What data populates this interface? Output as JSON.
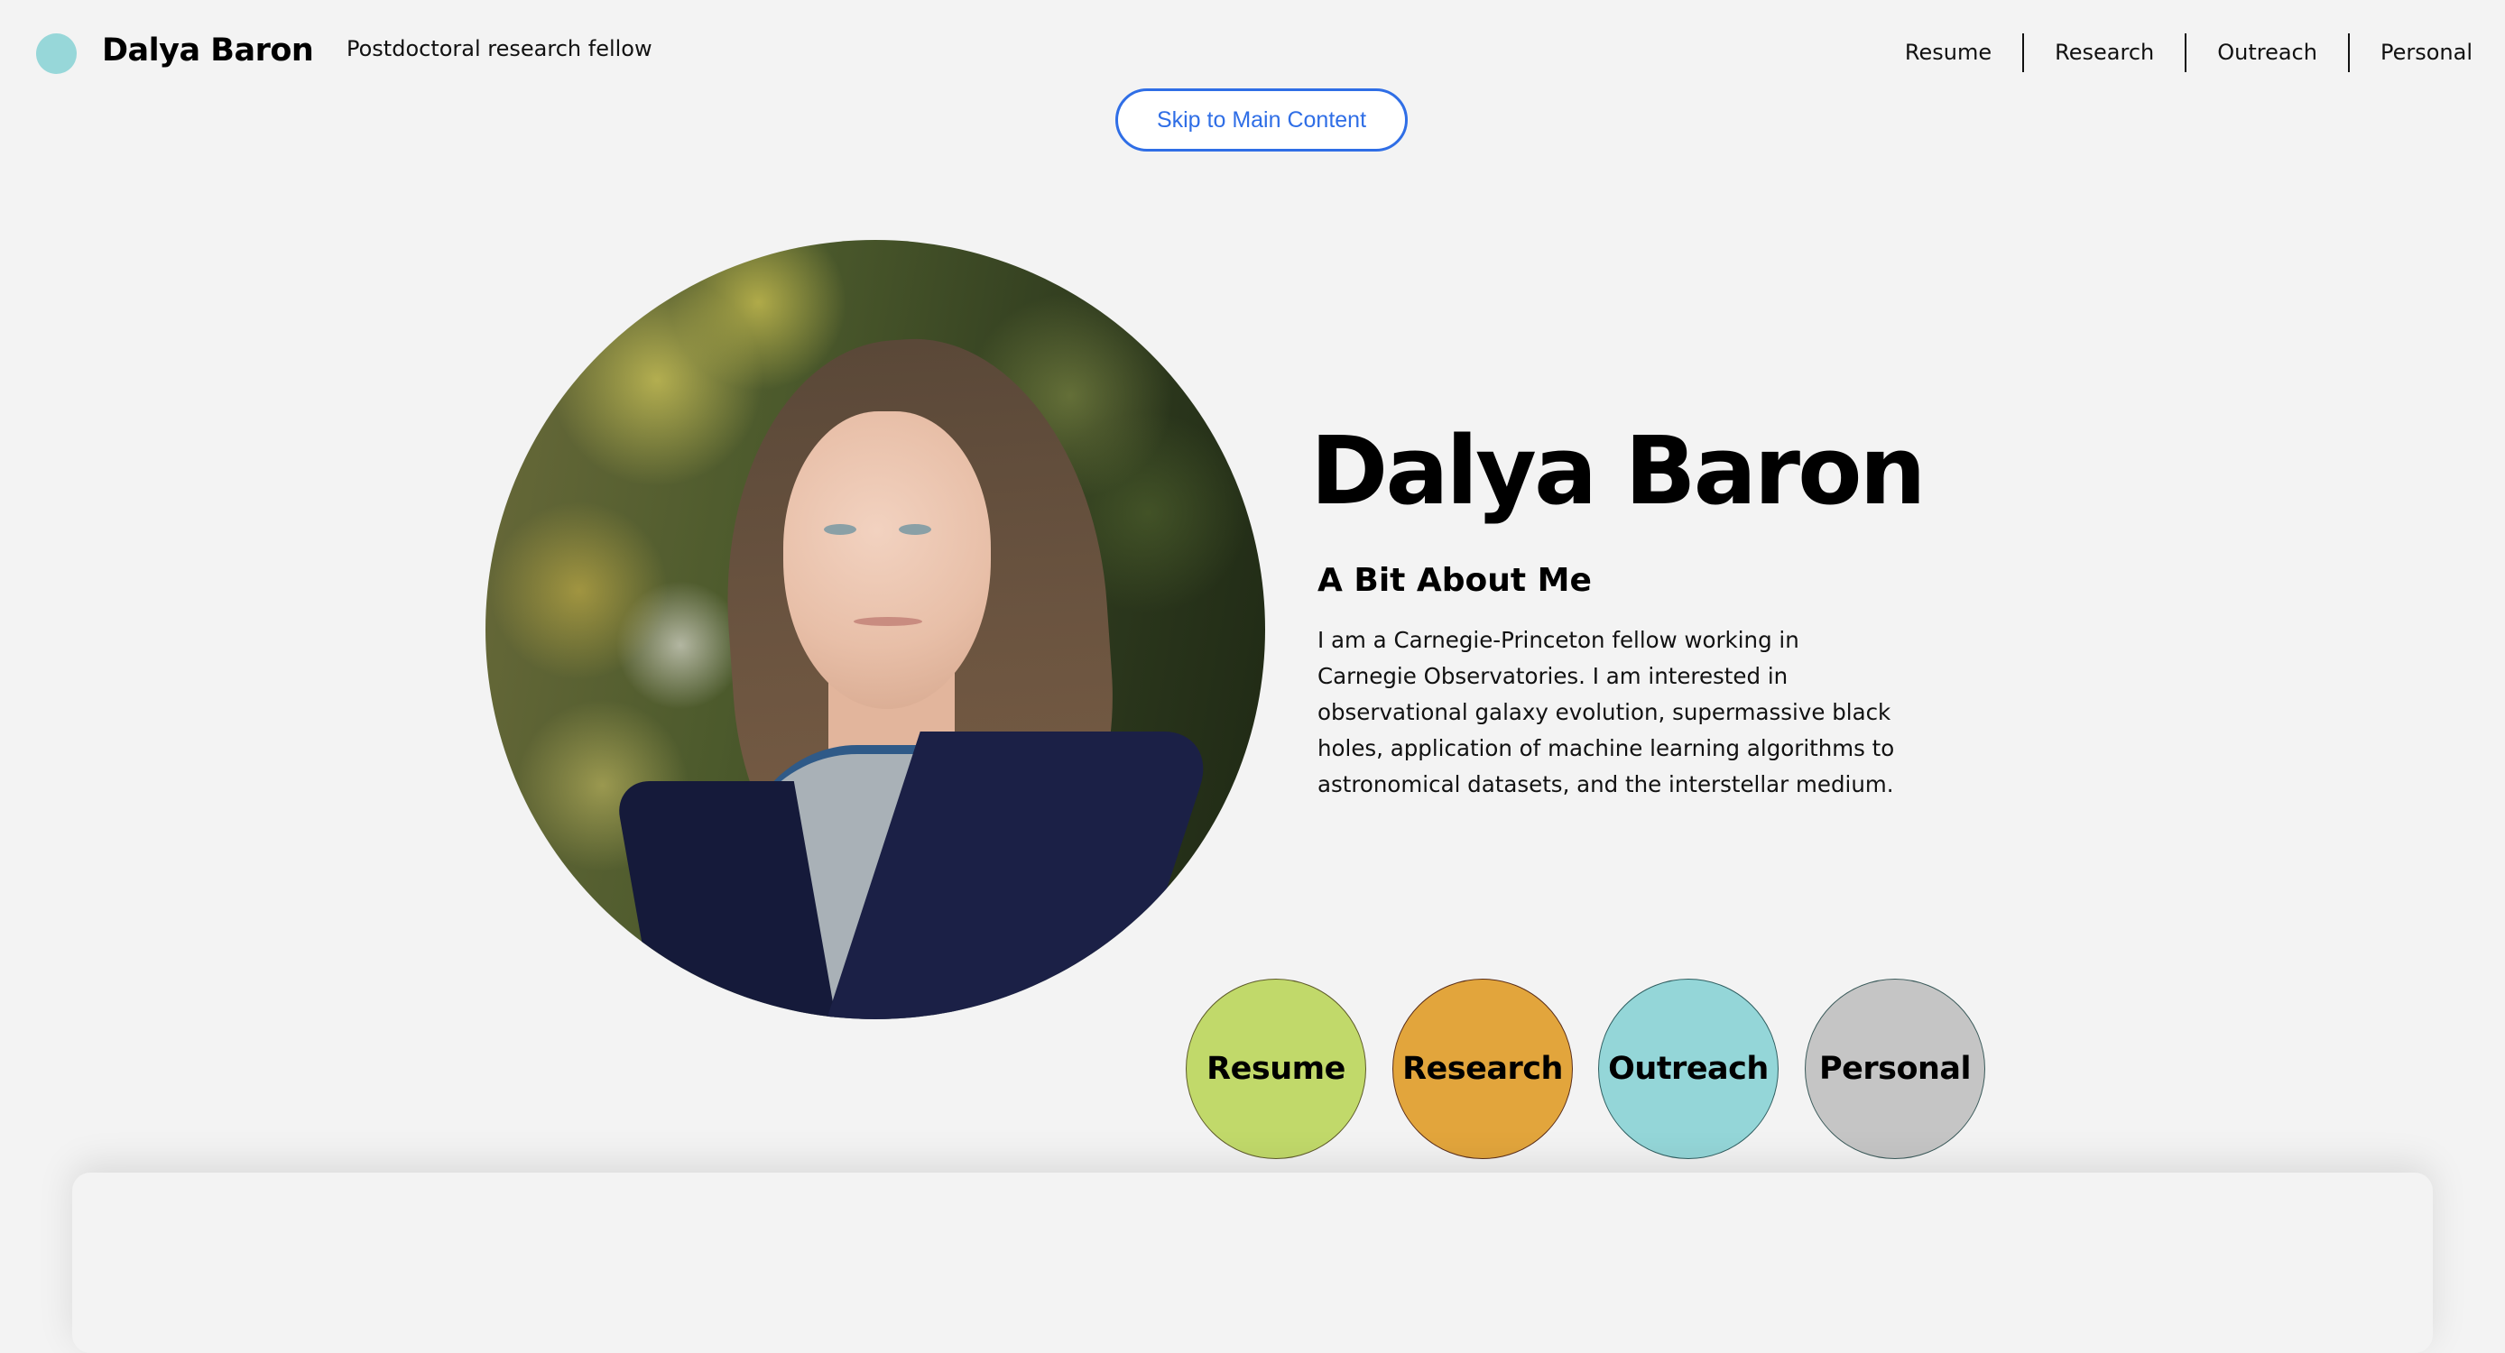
{
  "header": {
    "site_title": "Dalya Baron",
    "tagline": "Postdoctoral research fellow",
    "logo_icon": "teal-dot-icon",
    "nav": [
      {
        "label": "Resume"
      },
      {
        "label": "Research"
      },
      {
        "label": "Outreach"
      },
      {
        "label": "Personal"
      }
    ]
  },
  "skip_link": {
    "label": "Skip to Main Content"
  },
  "intro": {
    "portrait_alt": "Portrait of Dalya Baron",
    "heading": "Dalya Baron",
    "about_heading": "A Bit About Me",
    "about_lines": [
      "I am a Carnegie-Princeton fellow working in",
      "Carnegie Observatories. I am interested in",
      "observational galaxy evolution, supermassive black",
      "holes, application of machine learning algorithms to",
      "astronomical datasets, and the interstellar medium."
    ]
  },
  "sections": [
    {
      "label": "Resume",
      "color": "#c1d96a"
    },
    {
      "label": "Research",
      "color": "#e2a53c"
    },
    {
      "label": "Outreach",
      "color": "#94d6d8"
    },
    {
      "label": "Personal",
      "color": "#c5c5c5"
    }
  ],
  "colors": {
    "background": "#f3f3f3",
    "accent_blue": "#2f6ee6",
    "logo_teal": "#97d7d9"
  }
}
